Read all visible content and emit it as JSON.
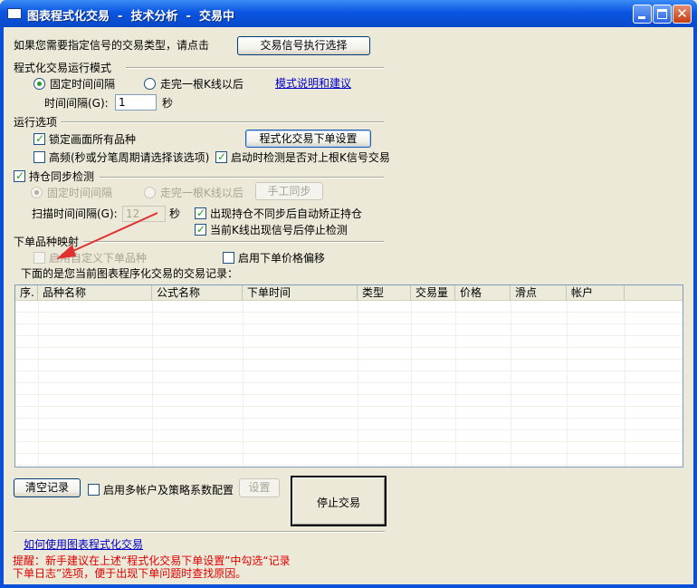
{
  "window": {
    "title": "图表程式化交易  -  技术分析  -  交易中"
  },
  "signal_select": {
    "prompt": "如果您需要指定信号的交易类型，请点击",
    "button_label": "交易信号执行选择"
  },
  "mode_group": {
    "title": "程式化交易运行模式",
    "option_fixed": "固定时间间隔",
    "option_bar": "走完一根K线以后",
    "selected": "固定时间间隔",
    "help_link": "模式说明和建议",
    "interval_label": "时间间隔(G):",
    "interval_value": "1",
    "interval_unit": "秒"
  },
  "run_options": {
    "title": "运行选项",
    "lock_all_label": "锁定画面所有品种",
    "lock_all_checked": true,
    "order_settings_button": "程式化交易下单设置",
    "high_freq_label": "高频(秒或分笔周期请选择该选项)",
    "high_freq_checked": false,
    "startup_check_label": "启动时检测是否对上根K信号交易",
    "startup_check_checked": true
  },
  "position_sync": {
    "title": "持仓同步检测",
    "checked": true,
    "option_fixed": "固定时间间隔",
    "option_bar": "走完一根K线以后",
    "manual_sync_button": "手工同步",
    "scan_interval_label": "扫描时间间隔(G):",
    "scan_interval_value": "12",
    "scan_interval_unit": "秒",
    "auto_correct_label": "出现持仓不同步后自动矫正持仓",
    "auto_correct_checked": true,
    "stop_on_signal_label": "当前K线出现信号后停止检测",
    "stop_on_signal_checked": true
  },
  "symbol_mapping": {
    "title": "下单品种映射",
    "custom_symbol_label": "启用自定义下单品种",
    "custom_symbol_checked": false,
    "price_offset_label": "启用下单价格偏移",
    "price_offset_checked": false
  },
  "records": {
    "caption": "下面的是您当前图表程序化交易的交易记录：",
    "columns": [
      "序.",
      "品种名称",
      "公式名称",
      "下单时间",
      "类型",
      "交易量",
      "价格",
      "滑点",
      "帐户"
    ],
    "rows": []
  },
  "bottom": {
    "clear_button": "清空记录",
    "multi_account_label": "启用多帐户及策略系数配置",
    "multi_account_checked": false,
    "settings_button": "设置",
    "stop_button": "停止交易",
    "howto_link": "如何使用图表程式化交易",
    "hint_line1": "提醒：新手建议在上述“程式化交易下单设置”中勾选“记录",
    "hint_line2": "下单日志”选项，便于出现下单问题时查找原因。"
  },
  "colors": {
    "title_bar": "#0b55e2",
    "dialog_bg": "#ece9d8",
    "link": "#0000c8",
    "hint_text": "#e00000",
    "annotation_arrow": "#e03030"
  },
  "icons": [
    "app-window-icon",
    "minimize-icon",
    "maximize-icon",
    "close-icon",
    "red-arrow-annotation"
  ]
}
